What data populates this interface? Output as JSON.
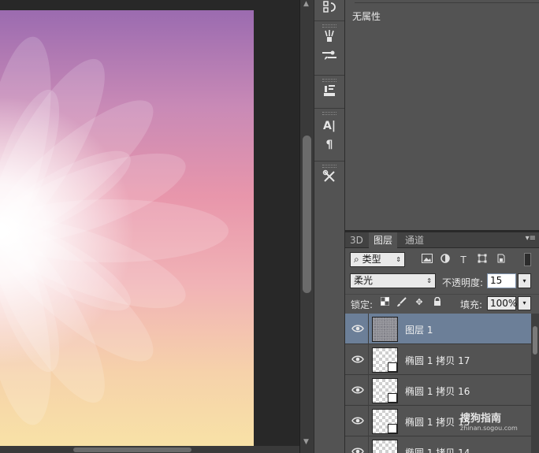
{
  "properties": {
    "title": "无属性"
  },
  "layers_panel": {
    "tabs": [
      {
        "label": "3D"
      },
      {
        "label": "图层"
      },
      {
        "label": "通道"
      }
    ],
    "filter": {
      "kind_label": "类型"
    },
    "blend_mode": "柔光",
    "opacity_label": "不透明度:",
    "opacity_value": "15",
    "lock_label": "锁定:",
    "fill_label": "填充:",
    "fill_value": "100%",
    "layers": [
      {
        "name": "图层 1"
      },
      {
        "name": "椭圆 1 拷贝 17"
      },
      {
        "name": "椭圆 1 拷贝 16"
      },
      {
        "name": "椭圆 1 拷贝 15"
      },
      {
        "name": "椭圆 1 拷贝 14"
      }
    ]
  },
  "icons": {
    "tools": [
      "history-icon",
      "brush-presets-icon",
      "brush-icon",
      "clone-source-icon",
      "character-icon",
      "paragraph-icon",
      "tool-presets-icon"
    ]
  },
  "watermark": {
    "brand": "搜狗指南",
    "url": "zhinan.sogou.com"
  }
}
